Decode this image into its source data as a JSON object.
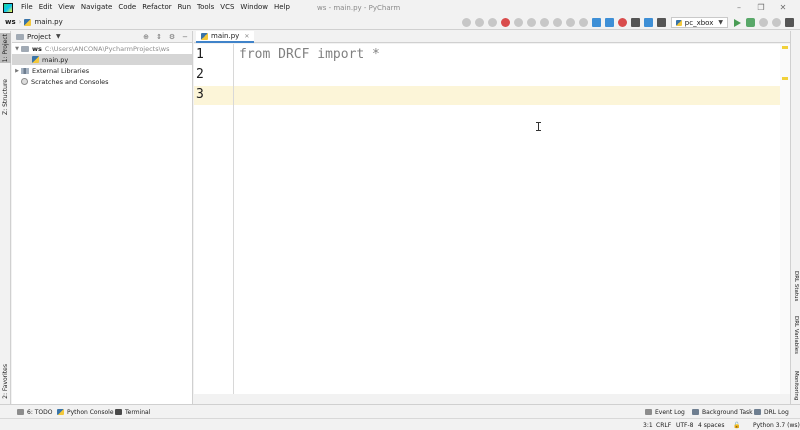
{
  "window": {
    "title": "ws - main.py - PyCharm",
    "menu": [
      "File",
      "Edit",
      "View",
      "Navigate",
      "Code",
      "Refactor",
      "Run",
      "Tools",
      "VCS",
      "Window",
      "Help"
    ],
    "controls": [
      "–",
      "❐",
      "✕"
    ]
  },
  "navbar": {
    "root": "ws",
    "file": "main.py",
    "run_config": "pc_xbox"
  },
  "left_strip": {
    "tabs": [
      "1: Project",
      "Z: Structure",
      "2: Favorites"
    ]
  },
  "project_panel": {
    "title": "Project",
    "tree": {
      "root_name": "ws",
      "root_path": "C:\\Users\\ANCONA\\PycharmProjects\\ws",
      "file": "main.py",
      "external_libraries": "External Libraries",
      "scratches": "Scratches and Consoles"
    }
  },
  "editor": {
    "tab": "main.py",
    "line_numbers": [
      "1",
      "2",
      "3"
    ],
    "lines": [
      "from DRCF import *",
      "",
      ""
    ],
    "current_line": 3
  },
  "right_strip": {
    "tabs": [
      "DRL Status",
      "DRL Variables",
      "Monitoring"
    ]
  },
  "bottom_tools": {
    "todo": "6: TODO",
    "python_console": "Python Console",
    "terminal": "Terminal",
    "event_log": "Event Log",
    "background_task": "Background Task",
    "drl_log": "DRL Log"
  },
  "status_bar": {
    "position": "3:1",
    "line_sep": "CRLF",
    "encoding": "UTF-8",
    "indent": "4 spaces",
    "interpreter": "Python 3.7 (ws)"
  },
  "colors": {
    "current_line": "#fcf5d8",
    "code_text": "#808080",
    "tab_underline": "#4083c9"
  }
}
